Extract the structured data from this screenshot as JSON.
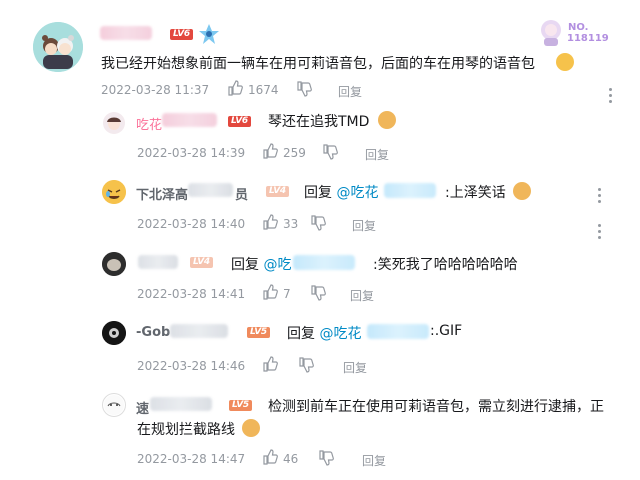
{
  "comment": {
    "text": "我已经开始想象前面一辆车在用可莉语音包，后面的车在用琴的语音包",
    "time": "2022-03-28 11:37",
    "likes": "1674",
    "reply_label": "回复",
    "level": "LV6",
    "badge_no": "NO.",
    "badge_num": "118119"
  },
  "replies": [
    {
      "name_visible": "吃花",
      "level": "LV6",
      "prefix": "",
      "mention": "",
      "text": "琴还在追我TMD",
      "time": "2022-03-28 14:39",
      "likes": "259",
      "reply_label": "回复"
    },
    {
      "name_visible": "下北泽高",
      "name_tail": "员",
      "level": "LV4",
      "prefix": "回复 ",
      "mention": "@吃花",
      "text": ":上泽笑话",
      "time": "2022-03-28 14:40",
      "likes": "33",
      "reply_label": "回复"
    },
    {
      "name_visible": "",
      "level": "LV4",
      "prefix": "回复 ",
      "mention": "@吃",
      "text": ":笑死我了哈哈哈哈哈哈",
      "time": "2022-03-28 14:41",
      "likes": "7",
      "reply_label": "回复"
    },
    {
      "name_visible": "-Gob",
      "level": "LV5",
      "prefix": "回复 ",
      "mention": "@吃花",
      "text": ":.GIF",
      "time": "2022-03-28 14:46",
      "likes": "",
      "reply_label": "回复"
    },
    {
      "name_visible": "速",
      "level": "LV5",
      "prefix": "",
      "mention": "",
      "text": "检测到前车正在使用可莉语音包，需立刻进行逮捕，正",
      "text2": "在规划拦截路线",
      "time": "2022-03-28 14:47",
      "likes": "46",
      "reply_label": "回复"
    }
  ],
  "colors": {
    "accent_pink": "#fb7299",
    "link_blue": "#008ac5",
    "meta_gray": "#9499a0",
    "level_red": "#e3483e"
  },
  "icons": [
    "like-icon",
    "dislike-icon",
    "more-icon",
    "emoji-sticker"
  ]
}
